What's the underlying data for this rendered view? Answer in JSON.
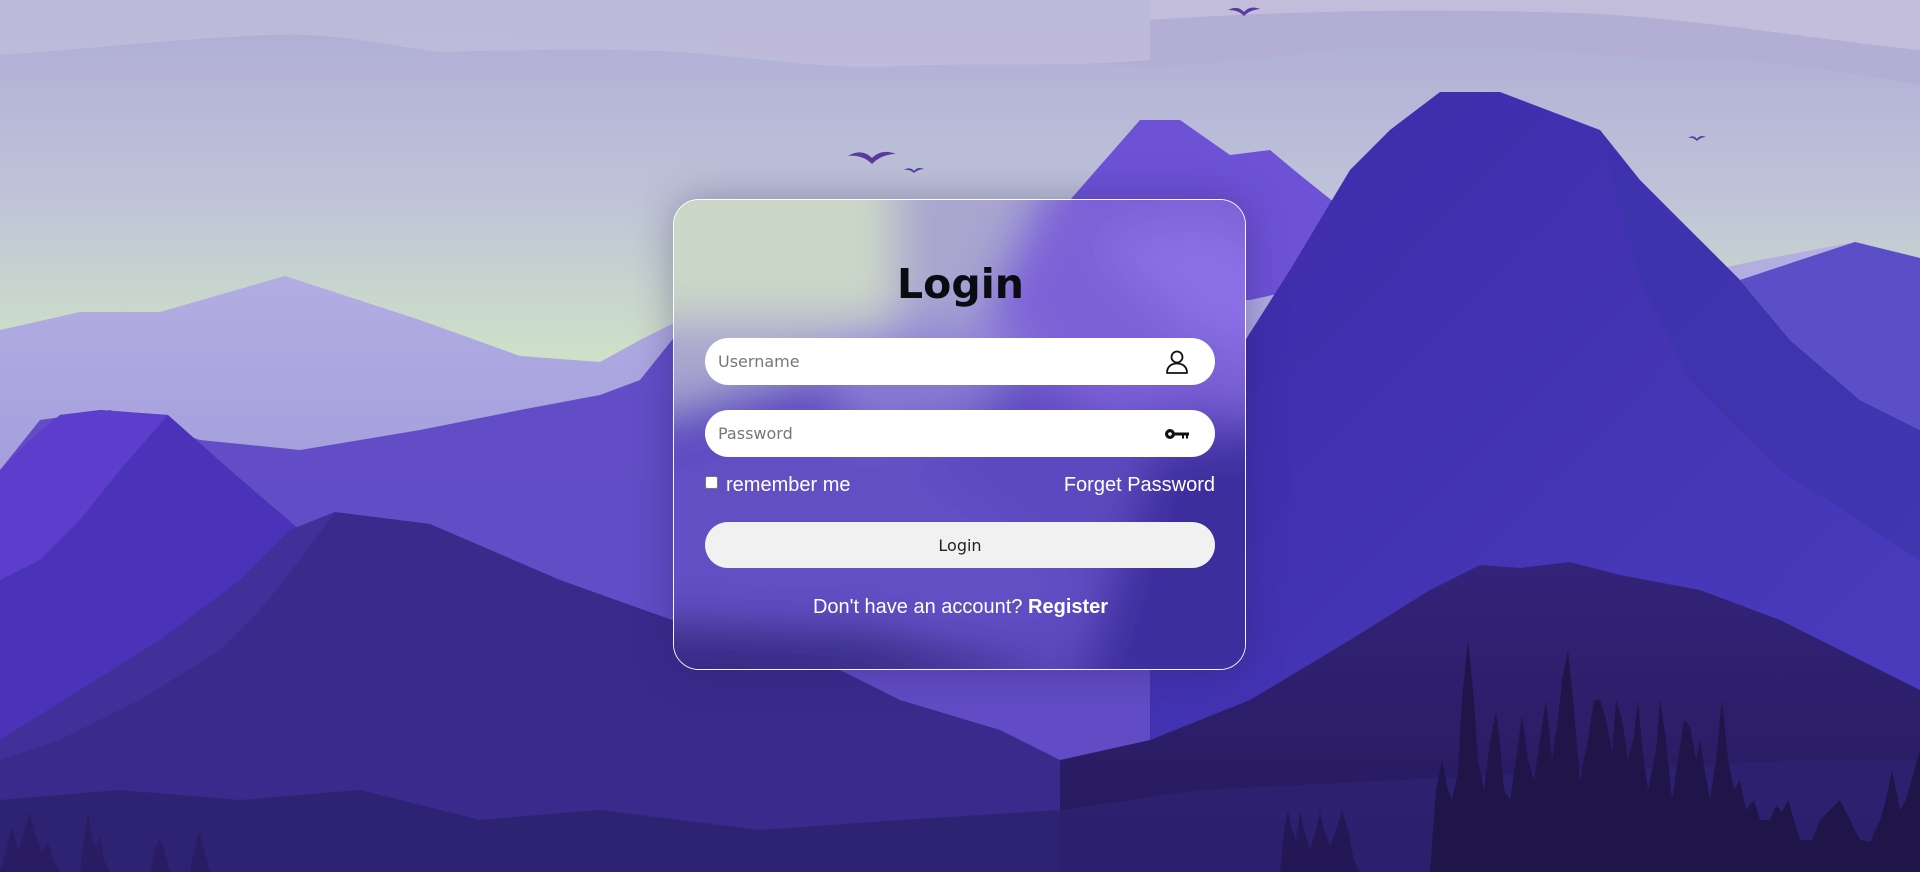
{
  "login_form": {
    "title": "Login",
    "username": {
      "placeholder": "Username",
      "value": "",
      "icon": "person-icon"
    },
    "password": {
      "placeholder": "Password",
      "value": "",
      "icon": "key-icon"
    },
    "remember_me": {
      "label": "remember me",
      "checked": false
    },
    "forget_password_label": "Forget Password",
    "login_button_label": "Login",
    "register_prompt": "Don't have an account?",
    "register_link_label": "Register"
  },
  "colors": {
    "sky_top": "#b6b2d8",
    "sky_horizon": "#cde0c6",
    "mountain_purple": "#4a33b0",
    "mountain_dark": "#2b1d66",
    "card_border": "#ffffff",
    "input_background": "#ffffff",
    "button_background": "#f1f1f1",
    "text_white": "#ffffff"
  }
}
